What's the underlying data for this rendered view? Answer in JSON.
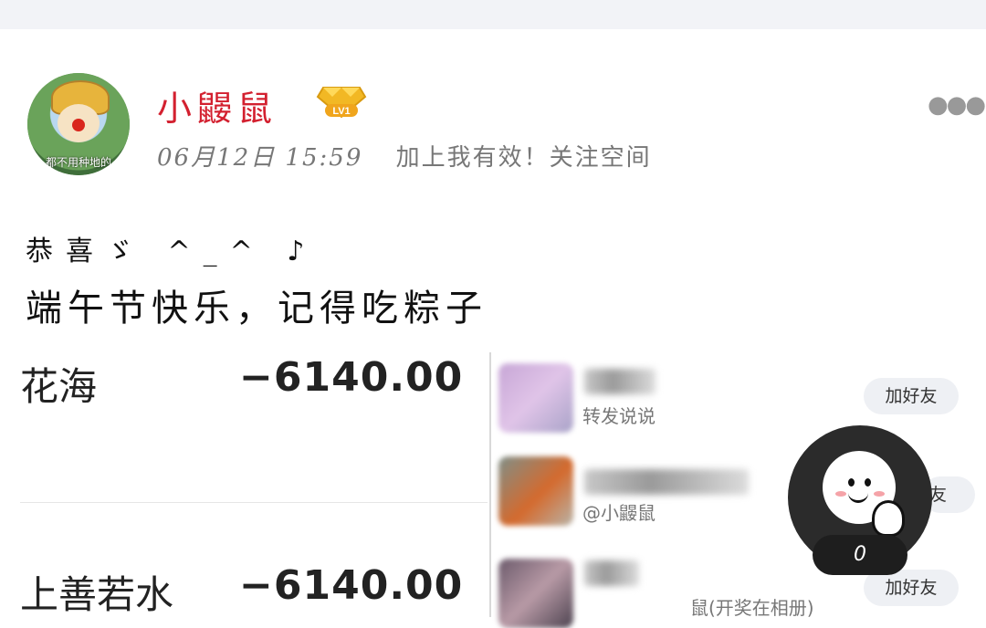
{
  "post": {
    "username": "小鼹鼠",
    "level_badge": "LV1",
    "timestamp": "06月12日 15:59",
    "source_text": "加上我有效！关注空间",
    "avatar_caption": "都不用种地的",
    "content_line1": "恭喜ゞ ^_^ ♪",
    "content_line2": "端午节快乐，记得吃粽子",
    "more_icon": "more-horizontal-icon"
  },
  "attachment": {
    "transactions": [
      {
        "name": "花海",
        "amount": "−6140.00"
      },
      {
        "name": "上善若水",
        "amount": "−6140.00"
      }
    ],
    "friends": [
      {
        "subtext": "转发说说",
        "button": "加好友"
      },
      {
        "subtext": "@小鼹鼠",
        "button": "友"
      },
      {
        "subtext": "鼠(开奖在相册)",
        "button": "加好友"
      }
    ],
    "bubble_counter": "0"
  },
  "colors": {
    "username": "#d3202f",
    "badge": "#f2b824",
    "meta": "#777777",
    "bubble": "#2b2b2b"
  }
}
